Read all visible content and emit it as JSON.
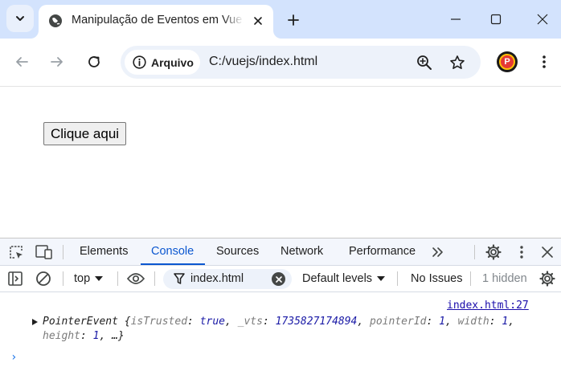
{
  "browser": {
    "tab_title": "Manipulação de Eventos em Vue.js",
    "omnibox": {
      "chip_label": "Arquivo",
      "url": "C:/vuejs/index.html"
    },
    "profile_letter": "P"
  },
  "page": {
    "button_label": "Clique aqui"
  },
  "devtools": {
    "tabs": [
      {
        "label": "Elements"
      },
      {
        "label": "Console",
        "active": true
      },
      {
        "label": "Sources"
      },
      {
        "label": "Network"
      },
      {
        "label": "Performance"
      }
    ],
    "filterbar": {
      "context": "top",
      "filter_value": "index.html",
      "levels": "Default levels",
      "issues": "No Issues",
      "hidden": "1 hidden"
    },
    "console": {
      "source_link": "index.html:27",
      "log": {
        "class_name": "PointerEvent",
        "props": [
          {
            "key": "isTrusted",
            "value": "true"
          },
          {
            "key": "_vts",
            "value": "1735827174894"
          },
          {
            "key": "pointerId",
            "value": "1"
          },
          {
            "key": "width",
            "value": "1"
          },
          {
            "key": "height",
            "value": "1"
          }
        ],
        "ellipsis": "…"
      }
    }
  },
  "colors": {
    "tabstrip": "#d3e3fd",
    "accent": "#0b57d0",
    "link": "#1a0dab"
  }
}
